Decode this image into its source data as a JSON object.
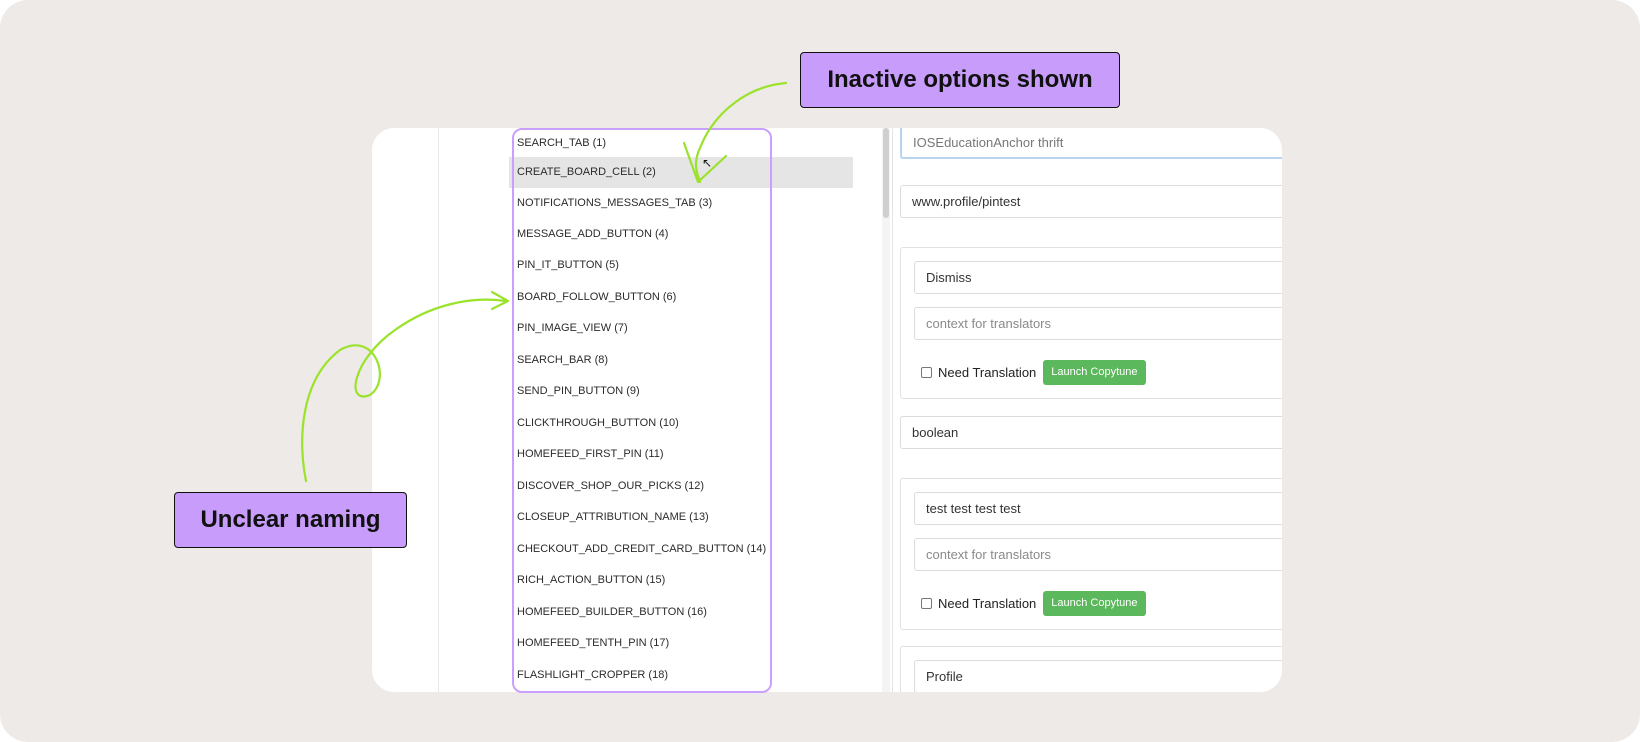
{
  "annotations": {
    "inactive_options": "Inactive options shown",
    "unclear_naming": "Unclear naming"
  },
  "list": {
    "items": [
      "SEARCH_TAB (1)",
      "CREATE_BOARD_CELL (2)",
      "NOTIFICATIONS_MESSAGES_TAB (3)",
      "MESSAGE_ADD_BUTTON (4)",
      "PIN_IT_BUTTON (5)",
      "BOARD_FOLLOW_BUTTON (6)",
      "PIN_IMAGE_VIEW (7)",
      "SEARCH_BAR (8)",
      "SEND_PIN_BUTTON (9)",
      "CLICKTHROUGH_BUTTON (10)",
      "HOMEFEED_FIRST_PIN (11)",
      "DISCOVER_SHOP_OUR_PICKS (12)",
      "CLOSEUP_ATTRIBUTION_NAME (13)",
      "CHECKOUT_ADD_CREDIT_CARD_BUTTON (14)",
      "RICH_ACTION_BUTTON (15)",
      "HOMEFEED_BUILDER_BUTTON (16)",
      "HOMEFEED_TENTH_PIN (17)",
      "FLASHLIGHT_CROPPER (18)"
    ],
    "hovered_index": 1
  },
  "form": {
    "anchor_value": "IOSEducationAnchor thrift",
    "url_value": "www.profile/pintest",
    "group1": {
      "text_value": "Dismiss",
      "context_placeholder": "context for translators",
      "need_translation_label": "Need Translation",
      "launch_button": "Launch Copytune"
    },
    "type_value": "boolean",
    "group2": {
      "text_value": "test test test test",
      "context_placeholder": "context for translators",
      "need_translation_label": "Need Translation",
      "launch_button": "Launch Copytune"
    },
    "group3": {
      "text_value": "Profile"
    }
  },
  "colors": {
    "callout_bg": "#c89cfa",
    "highlight_border": "#c9a0ff",
    "arrow": "#9be22a",
    "button_green": "#5cb85c"
  }
}
